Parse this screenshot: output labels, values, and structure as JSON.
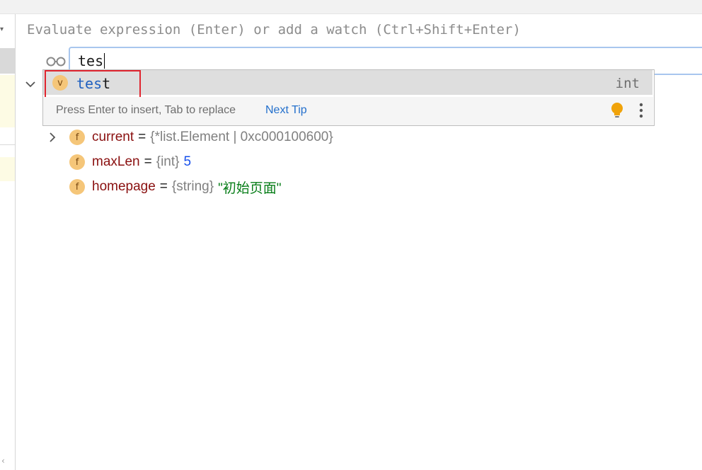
{
  "evaluate": {
    "placeholder": "Evaluate expression (Enter) or add a watch (Ctrl+Shift+Enter)"
  },
  "watch": {
    "input_value": "tes"
  },
  "completion": {
    "item": {
      "badge": "v",
      "name_match": "tes",
      "name_rest": "t",
      "type": "int"
    },
    "footer_hint": "Press Enter to insert, Tab to replace",
    "footer_link": "Next Tip"
  },
  "variables": [
    {
      "badge": "f",
      "name": "current",
      "eq": "=",
      "type": "{*list.Element | 0xc000100600}",
      "value": "",
      "expandable": true
    },
    {
      "badge": "f",
      "name": "maxLen",
      "eq": "=",
      "type": "{int}",
      "value": "5",
      "expandable": false
    },
    {
      "badge": "f",
      "name": "homepage",
      "eq": "=",
      "type": "{string}",
      "value": "\"初始页面\"",
      "expandable": false
    }
  ],
  "colors": {
    "accent": "#2470cc",
    "highlight_border": "#e0252f",
    "badge_bg": "#f5c679",
    "string_value": "#067d17",
    "number_value": "#1750eb"
  },
  "icons": [
    "glasses-icon",
    "chevron-down-icon",
    "chevron-right-icon",
    "lightbulb-icon",
    "more-vertical-icon",
    "chevron-left-icon"
  ]
}
